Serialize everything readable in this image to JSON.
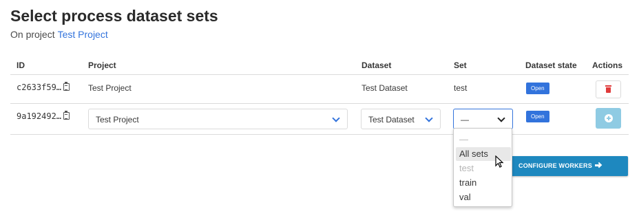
{
  "page": {
    "title": "Select process dataset sets",
    "subtitle_prefix": "On project",
    "project_link": "Test Project"
  },
  "table": {
    "headers": [
      "ID",
      "Project",
      "Dataset",
      "Set",
      "Dataset state",
      "Actions"
    ],
    "rows": [
      {
        "id": "c2633f59…",
        "project": "Test Project",
        "dataset": "Test Dataset",
        "set": "test",
        "state": "Open"
      },
      {
        "id": "9a192492…",
        "project": "Test Project",
        "dataset": "Test Dataset",
        "set": "—",
        "state": "Open"
      }
    ]
  },
  "dropdown": {
    "options": [
      "—",
      "All sets",
      "test",
      "train",
      "val"
    ],
    "hovered": "All sets",
    "disabled": [
      "test"
    ]
  },
  "configure_button": "CONFIGURE WORKERS",
  "colors": {
    "primary": "#3273dc",
    "danger": "#e03b3b",
    "add_button": "#8fcbe3",
    "configure_button": "#1e88bf"
  },
  "icons": [
    "clipboard-icon",
    "trash-icon",
    "plus-circle-icon",
    "chevron-down-icon",
    "arrow-right-icon",
    "mouse-cursor-icon"
  ]
}
